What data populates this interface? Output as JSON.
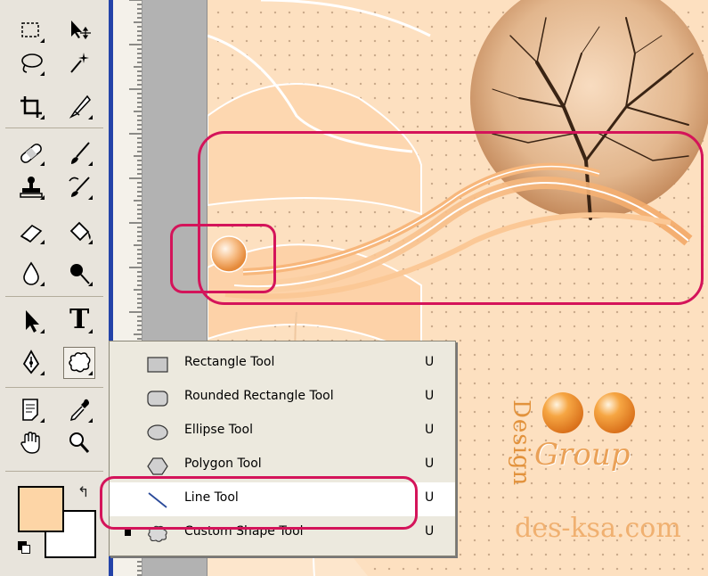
{
  "toolbox": {
    "tools": [
      {
        "name": "rectangular-marquee-tool",
        "icon": "marquee-rect-icon"
      },
      {
        "name": "move-tool",
        "icon": "move-arrow-icon"
      },
      {
        "name": "lasso-tool",
        "icon": "lasso-icon"
      },
      {
        "name": "magic-wand-tool",
        "icon": "magic-wand-icon"
      },
      {
        "name": "crop-tool",
        "icon": "crop-icon"
      },
      {
        "name": "slice-tool",
        "icon": "slice-knife-icon"
      },
      {
        "name": "healing-brush-tool",
        "icon": "bandage-icon"
      },
      {
        "name": "brush-tool",
        "icon": "brush-icon"
      },
      {
        "name": "clone-stamp-tool",
        "icon": "stamp-icon"
      },
      {
        "name": "history-brush-tool",
        "icon": "history-brush-icon"
      },
      {
        "name": "eraser-tool",
        "icon": "eraser-icon"
      },
      {
        "name": "paint-bucket-tool",
        "icon": "bucket-icon"
      },
      {
        "name": "blur-tool",
        "icon": "water-drop-icon"
      },
      {
        "name": "dodge-tool",
        "icon": "dodge-pin-icon"
      },
      {
        "name": "path-selection-tool",
        "icon": "arrow-select-icon"
      },
      {
        "name": "type-tool",
        "icon": "type-t-icon",
        "label": "T"
      },
      {
        "name": "pen-tool",
        "icon": "pen-nib-icon"
      },
      {
        "name": "custom-shape-tool",
        "icon": "custom-shape-icon"
      },
      {
        "name": "notes-tool",
        "icon": "notes-icon"
      },
      {
        "name": "eyedropper-tool",
        "icon": "eyedropper-icon"
      },
      {
        "name": "hand-tool",
        "icon": "hand-icon"
      },
      {
        "name": "zoom-tool",
        "icon": "magnifier-icon"
      }
    ],
    "foreground_color": "#fdd5a6",
    "background_color": "#ffffff"
  },
  "shape_menu": {
    "items": [
      {
        "label": "Rectangle Tool",
        "shortcut": "U",
        "icon": "rectangle-shape-icon"
      },
      {
        "label": "Rounded Rectangle Tool",
        "shortcut": "U",
        "icon": "rounded-rectangle-icon"
      },
      {
        "label": "Ellipse Tool",
        "shortcut": "U",
        "icon": "ellipse-icon"
      },
      {
        "label": "Polygon Tool",
        "shortcut": "U",
        "icon": "polygon-icon"
      },
      {
        "label": "Line Tool",
        "shortcut": "U",
        "icon": "line-icon"
      },
      {
        "label": "Custom Shape Tool",
        "shortcut": "U",
        "icon": "custom-shape-icon"
      }
    ]
  },
  "watermark": {
    "design": "Design",
    "group": "Group",
    "site": "des-ksa.com"
  },
  "colors": {
    "annotation": "#d4145a",
    "canvas": "#fde0c0",
    "ruler_accent": "#2443a8"
  }
}
